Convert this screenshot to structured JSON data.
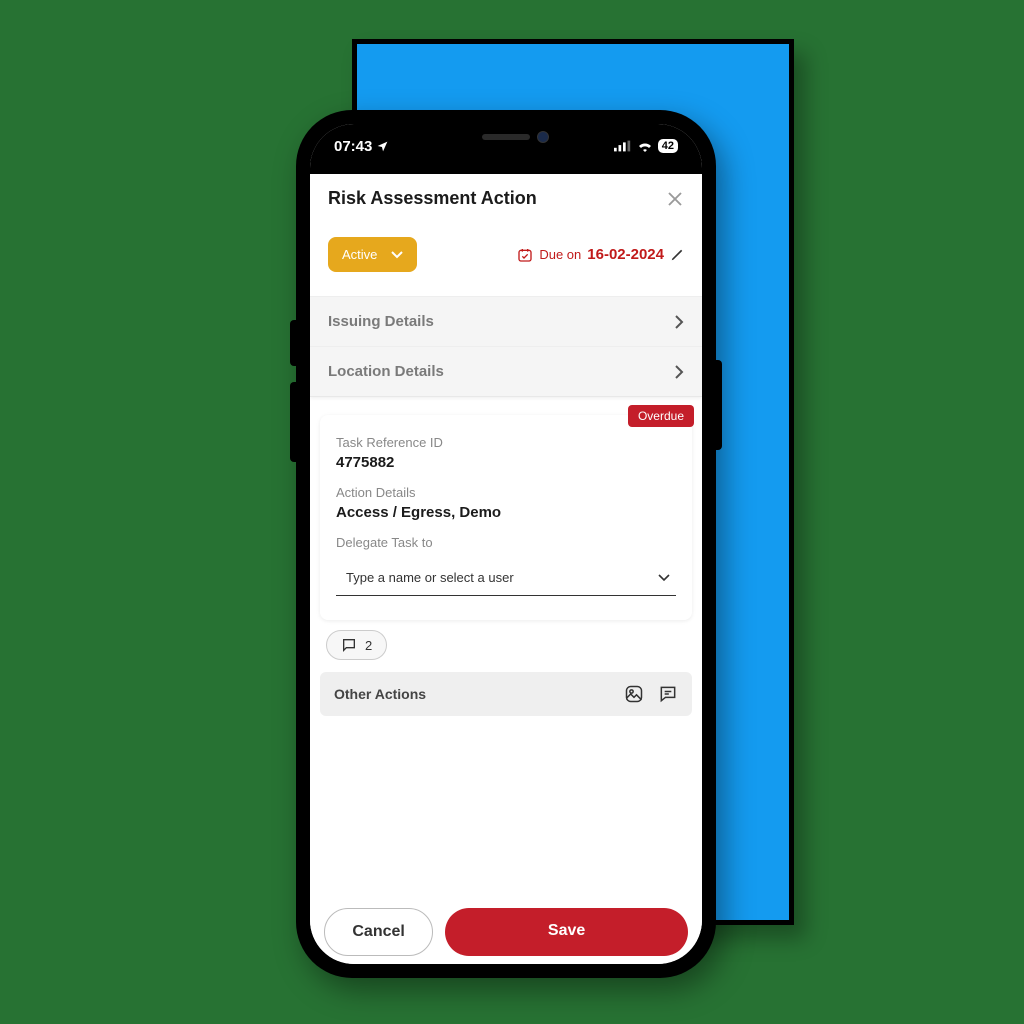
{
  "statusbar": {
    "time": "07:43",
    "battery": "42"
  },
  "header": {
    "title": "Risk Assessment Action"
  },
  "status": {
    "label": "Active"
  },
  "due": {
    "prefix": "Due on",
    "date": "16-02-2024"
  },
  "accordion": {
    "issuing": "Issuing Details",
    "location": "Location Details"
  },
  "badge": {
    "overdue": "Overdue"
  },
  "fields": {
    "task_ref_label": "Task Reference ID",
    "task_ref_value": "4775882",
    "action_details_label": "Action Details",
    "action_details_value": "Access / Egress, Demo",
    "delegate_label": "Delegate Task to",
    "delegate_placeholder": "Type a name or select a user"
  },
  "comments": {
    "count": "2"
  },
  "other": {
    "label": "Other Actions"
  },
  "footer": {
    "cancel": "Cancel",
    "save": "Save"
  }
}
